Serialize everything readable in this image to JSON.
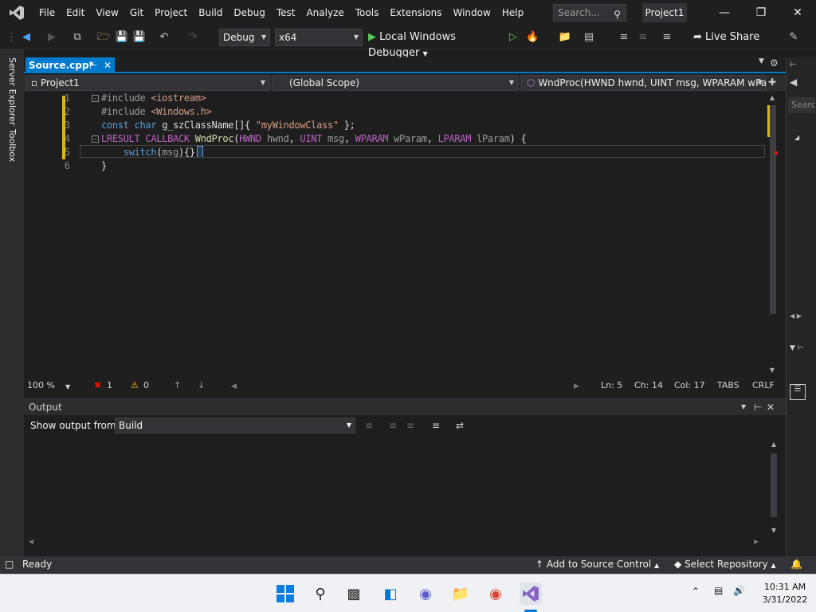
{
  "menu": {
    "items": [
      "File",
      "Edit",
      "View",
      "Git",
      "Project",
      "Build",
      "Debug",
      "Test",
      "Analyze",
      "Tools",
      "Extensions",
      "Window",
      "Help"
    ],
    "search_placeholder": "Search...",
    "project_name": "Project1"
  },
  "toolbar": {
    "config": "Debug",
    "platform": "x64",
    "debugger": "Local Windows Debugger",
    "live_share": "Live Share"
  },
  "left_rail": {
    "server_explorer": "Server Explorer",
    "toolbox": "Toolbox"
  },
  "editor": {
    "tab_label": "Source.cpp*",
    "nav": {
      "project": "Project1",
      "scope": "(Global Scope)",
      "member": "WndProc(HWND hwnd, UINT msg, WPARAM wPara"
    },
    "line_numbers": [
      "1",
      "2",
      "3",
      "4",
      "5",
      "6"
    ],
    "lines": [
      "#include <iostream>",
      "#include <Windows.h>",
      "const char g_szClassName[]{ \"myWindowClass\" };",
      "LRESULT CALLBACK WndProc(HWND hwnd, UINT msg, WPARAM wParam, LPARAM lParam) {",
      "    switch(msg){}",
      "}"
    ]
  },
  "editor_status": {
    "zoom": "100 %",
    "errors": "1",
    "warnings": "0",
    "ln": "Ln: 5",
    "ch": "Ch: 14",
    "col": "Col: 17",
    "tabs": "TABS",
    "eol": "CRLF"
  },
  "output": {
    "title": "Output",
    "show_from_label": "Show output from:",
    "source": "Build"
  },
  "statusbar": {
    "ready": "Ready",
    "source_control": "Add to Source Control",
    "repo": "Select Repository"
  },
  "taskbar": {
    "time": "10:31 AM",
    "date": "3/31/2022"
  },
  "colors": {
    "accent": "#007acc",
    "vs_purple": "#68217a",
    "keyword": "#569cd6",
    "type": "#4ec9b0",
    "string": "#d69d85",
    "macro": "#bd63c5"
  }
}
